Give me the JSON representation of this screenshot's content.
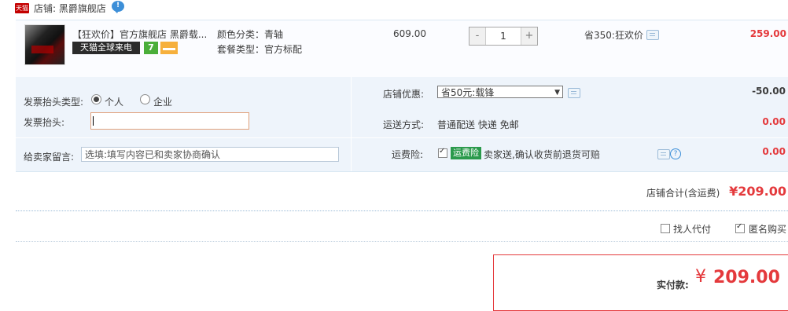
{
  "shop": {
    "badge": "天猫",
    "label": "店铺: 黑爵旗舰店"
  },
  "item": {
    "title": "【狂欢价】官方旗舰店 黑爵载...",
    "tag_global": "天猫全球来电",
    "tag_seven": "7",
    "attr_color": "颜色分类：青轴",
    "attr_package": "套餐类型：官方标配",
    "unit_price": "609.00",
    "quantity": "1",
    "qty_minus": "-",
    "qty_plus": "+",
    "promo_note": "省350:狂欢价",
    "subtotal": "259.00"
  },
  "invoice": {
    "type_label": "发票抬头类型:",
    "option_personal": "个人",
    "option_company": "企业",
    "title_label": "发票抬头:"
  },
  "memo": {
    "label": "给卖家留言:",
    "placeholder": "选填:填写内容已和卖家协商确认"
  },
  "store_discount": {
    "label": "店铺优惠:",
    "selected": "省50元:载锋",
    "value": "-50.00"
  },
  "shipping": {
    "label": "运送方式:",
    "method": "普通配送 快递 免邮",
    "value": "0.00"
  },
  "insurance": {
    "label": "运费险:",
    "badge": "运费险",
    "desc": "卖家送,确认收货前退货可赔",
    "value": "0.00"
  },
  "store_total": {
    "label": "店铺合计(含运费)",
    "value": "¥209.00"
  },
  "options": {
    "proxy_label": "找人代付",
    "anon_label": "匿名购买"
  },
  "payment": {
    "label": "实付款:",
    "currency": "¥",
    "amount": "209.00"
  },
  "colors": {
    "accent_red": "#e4393c",
    "panel_blue": "#eef4fb"
  }
}
